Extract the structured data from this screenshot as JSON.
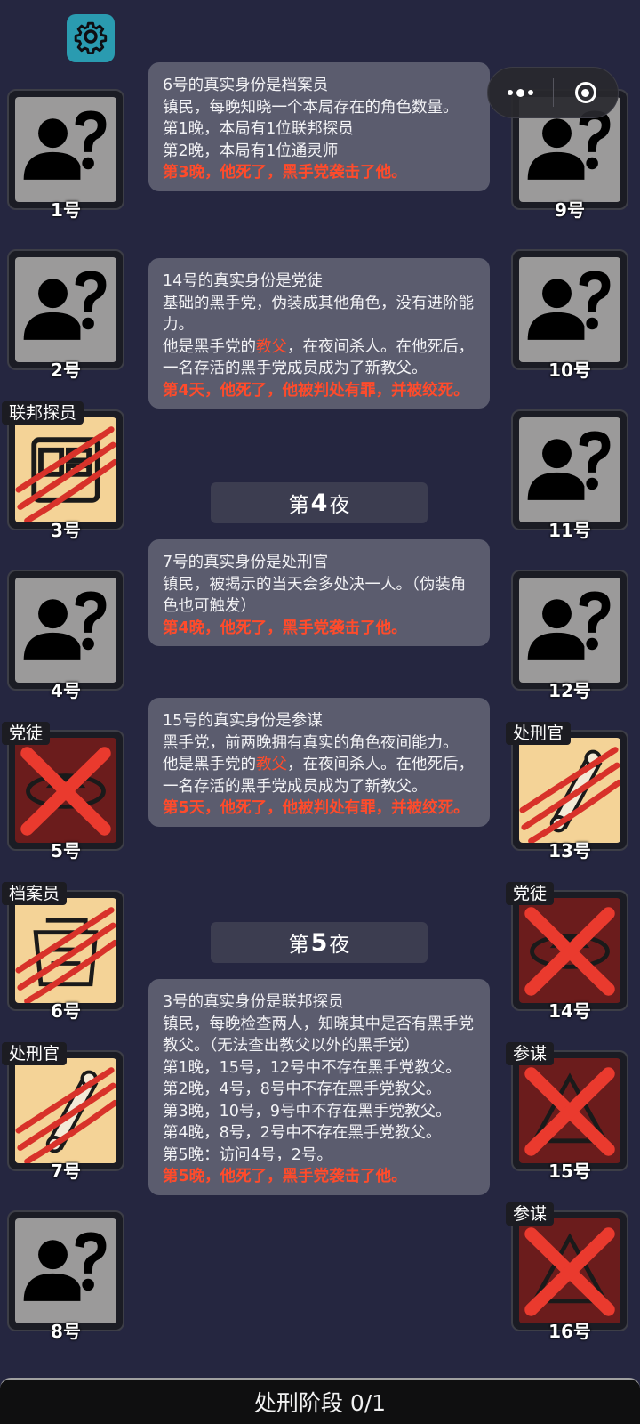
{
  "top": {
    "settings_icon": "gear-icon",
    "capsule_menu_icon": "more-dots-icon",
    "capsule_close_icon": "target-close-icon"
  },
  "players": [
    {
      "num": "1号",
      "side": "left",
      "state": "unknown",
      "role": ""
    },
    {
      "num": "2号",
      "side": "left",
      "state": "unknown",
      "role": ""
    },
    {
      "num": "3号",
      "side": "left",
      "state": "good-dead",
      "role": "联邦探员"
    },
    {
      "num": "4号",
      "side": "left",
      "state": "unknown",
      "role": ""
    },
    {
      "num": "5号",
      "side": "left",
      "state": "bad-dead",
      "role": "党徒"
    },
    {
      "num": "6号",
      "side": "left",
      "state": "good-dead",
      "role": "档案员"
    },
    {
      "num": "7号",
      "side": "left",
      "state": "good-dead",
      "role": "处刑官"
    },
    {
      "num": "8号",
      "side": "left",
      "state": "unknown",
      "role": ""
    },
    {
      "num": "9号",
      "side": "right",
      "state": "unknown",
      "role": ""
    },
    {
      "num": "10号",
      "side": "right",
      "state": "unknown",
      "role": ""
    },
    {
      "num": "11号",
      "side": "right",
      "state": "unknown",
      "role": ""
    },
    {
      "num": "12号",
      "side": "right",
      "state": "unknown",
      "role": ""
    },
    {
      "num": "13号",
      "side": "right",
      "state": "good-dead",
      "role": "处刑官"
    },
    {
      "num": "14号",
      "side": "right",
      "state": "bad-dead",
      "role": "党徒"
    },
    {
      "num": "15号",
      "side": "right",
      "state": "bad-dead",
      "role": "参谋"
    },
    {
      "num": "16号",
      "side": "right",
      "state": "bad-dead",
      "role": "参谋"
    }
  ],
  "feed": {
    "card1": {
      "title": "6号的真实身份是档案员",
      "lines": [
        "镇民，每晚知晓一个本局存在的角色数量。",
        "第1晚，本局有1位联邦探员",
        "第2晚，本局有1位通灵师"
      ],
      "death": "第3晚，他死了，黑手党袭击了他。"
    },
    "card2": {
      "title": "14号的真实身份是党徒",
      "desc": "基础的黑手党，伪装成其他角色，没有进阶能力。",
      "gf_pre": "他是黑手党的",
      "gf_word": "教父",
      "gf_post": "，在夜间杀人。在他死后，一名存活的黑手党成员成为了新教父。",
      "death": "第4天，他死了，他被判处有罪，并被绞死。"
    },
    "night4": {
      "pre": "第",
      "num": "4",
      "post": "夜"
    },
    "card3": {
      "title": "7号的真实身份是处刑官",
      "desc": "镇民，被揭示的当天会多处决一人。（伪装角色也可触发）",
      "death": "第4晚，他死了，黑手党袭击了他。"
    },
    "card4": {
      "title": "15号的真实身份是参谋",
      "desc": "黑手党，前两晚拥有真实的角色夜间能力。",
      "gf_pre": "他是黑手党的",
      "gf_word": "教父",
      "gf_post": "，在夜间杀人。在他死后，一名存活的黑手党成员成为了新教父。",
      "death": "第5天，他死了，他被判处有罪，并被绞死。"
    },
    "night5": {
      "pre": "第",
      "num": "5",
      "post": "夜"
    },
    "card5": {
      "title": "3号的真实身份是联邦探员",
      "desc": "镇民，每晚检查两人，知晓其中是否有黑手党教父。（无法查出教父以外的黑手党）",
      "lines": [
        "第1晚，15号，12号中不存在黑手党教父。",
        "第2晚，4号，8号中不存在黑手党教父。",
        "第3晚，10号，9号中不存在黑手党教父。",
        "第4晚，8号，2号中不存在黑手党教父。",
        "第5晚：访问4号，2号。"
      ],
      "death": "第5晚，他死了，黑手党袭击了他。"
    }
  },
  "phase_bar": "处刑阶段 0/1"
}
